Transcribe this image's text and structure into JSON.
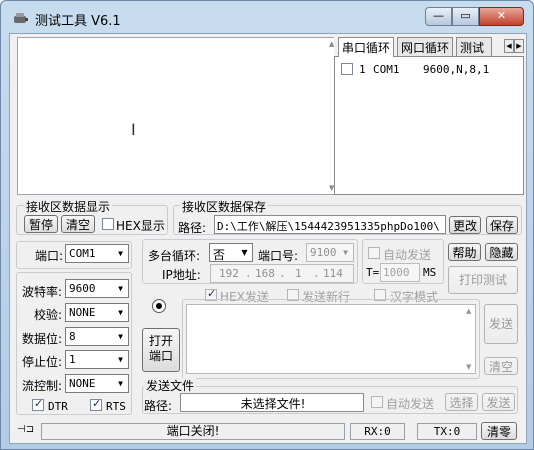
{
  "window": {
    "title": "测试工具 V6.1",
    "min_glyph": "—",
    "max_glyph": "▭",
    "close_glyph": "✕"
  },
  "tabs": {
    "items": [
      "串口循环",
      "网口循环",
      "测试"
    ],
    "left_arrow": "◀",
    "right_arrow": "▶"
  },
  "port_list": {
    "index": "1",
    "port": "COM1",
    "params": "9600,N,8,1"
  },
  "recv_display": {
    "group_title": "接收区数据显示",
    "pause_label": "暂停",
    "clear_label": "清空",
    "hex_label": "HEX显示"
  },
  "recv_save": {
    "group_title": "接收区数据保存",
    "path_label": "路径:",
    "path_value": "D:\\工作\\解压\\1544423951335phpDo100\\",
    "change_label": "更改",
    "save_label": "保存"
  },
  "serial": {
    "port_label": "端口:",
    "port_value": "COM1",
    "baud_label": "波特率:",
    "baud_value": "9600",
    "parity_label": "校验:",
    "parity_value": "NONE",
    "databits_label": "数据位:",
    "databits_value": "8",
    "stopbits_label": "停止位:",
    "stopbits_value": "1",
    "flow_label": "流控制:",
    "flow_value": "NONE",
    "dtr_label": "DTR",
    "rts_label": "RTS",
    "open_label": "打开\n端口"
  },
  "multi_loop": {
    "label": "多台循环:",
    "value": "否",
    "portno_label": "端口号:",
    "portno_value": "9100",
    "ip_label": "IP地址:",
    "ip": [
      "192",
      "168",
      "1",
      "114"
    ],
    "auto_send_label": "自动发送",
    "t_label": "T=",
    "t_value": "1000",
    "ms_label": "MS",
    "help_label": "帮助",
    "hide_label": "隐藏",
    "print_test_label": "打印测试"
  },
  "send_opts": {
    "hex_send_label": "HEX发送",
    "newline_label": "发送新行",
    "chinese_label": "汉字模式",
    "send_label": "发送",
    "clear_label": "清空"
  },
  "send_file": {
    "group_title": "发送文件",
    "path_label": "路径:",
    "path_value": "未选择文件!",
    "auto_send_label": "自动发送",
    "select_label": "选择",
    "send_label": "发送"
  },
  "status": {
    "pin_glyph": "⊣⊐",
    "port_state": "端口关闭!",
    "rx": "RX:0",
    "tx": "TX:0",
    "clear_label": "清零"
  },
  "colors": {
    "titlebar": "#b4cbe4",
    "close": "#c2412c",
    "disabled_text": "#a0a0a0"
  }
}
